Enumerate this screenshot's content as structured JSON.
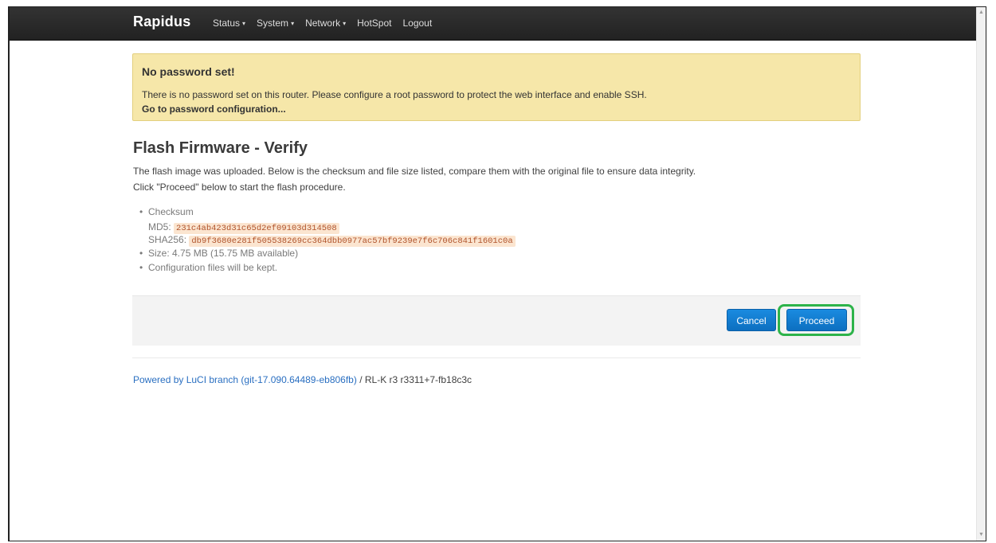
{
  "brand": "Rapidus",
  "nav": {
    "status": "Status",
    "system": "System",
    "network": "Network",
    "hotspot": "HotSpot",
    "logout": "Logout",
    "caret": "▾"
  },
  "alert": {
    "title": "No password set!",
    "text": "There is no password set on this router. Please configure a root password to protect the web interface and enable SSH.",
    "link": "Go to password configuration..."
  },
  "page": {
    "title": "Flash Firmware - Verify",
    "desc1": "The flash image was uploaded. Below is the checksum and file size listed, compare them with the original file to ensure data integrity.",
    "desc2": "Click \"Proceed\" below to start the flash procedure."
  },
  "info": {
    "checksum_label": "Checksum",
    "md5_label": "MD5:",
    "md5_value": "231c4ab423d31c65d2ef09103d314508",
    "sha256_label": "SHA256:",
    "sha256_value": "db9f3680e281f505538269cc364dbb0977ac57bf9239e7f6c706c841f1601c0a",
    "size": "Size: 4.75 MB (15.75 MB available)",
    "config": "Configuration files will be kept."
  },
  "actions": {
    "cancel": "Cancel",
    "proceed": "Proceed"
  },
  "footer": {
    "link": "Powered by LuCI branch (git-17.090.64489-eb806fb)",
    "rest": " / RL-K r3 r3311+7-fb18c3c"
  },
  "colors": {
    "navbar": "#222222",
    "alert_bg": "#f6e7a9",
    "button": "#0d6fc0",
    "highlight": "#2db34a",
    "link": "#2a6fc1"
  }
}
